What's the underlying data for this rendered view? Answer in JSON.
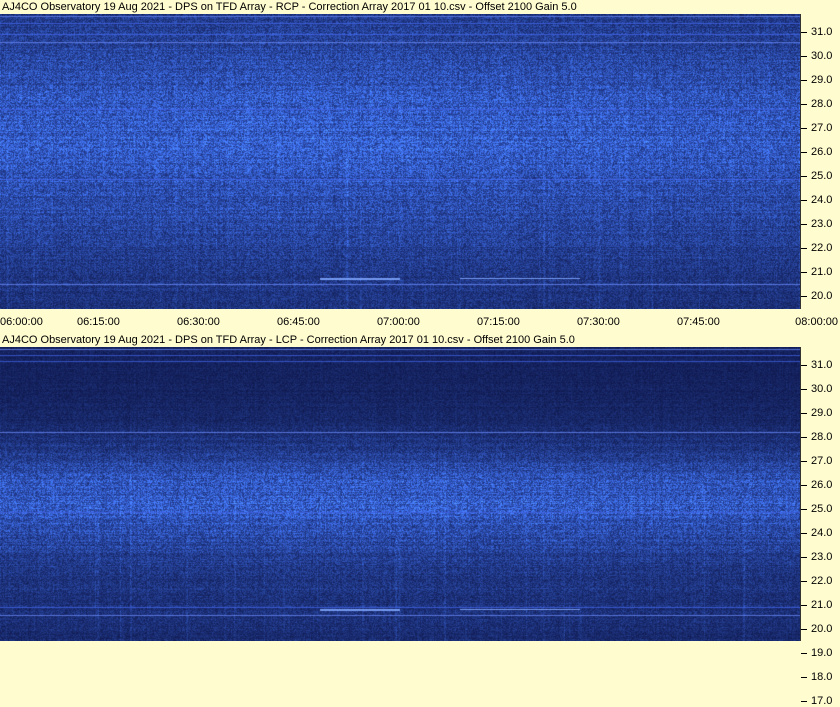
{
  "panels": [
    {
      "id": "rcp",
      "title": "AJ4CO Observatory 19 Aug 2021  -  DPS on TFD Array  -  RCP  -  Correction Array 2017 01 10.csv  -  Offset 2100  Gain 5.0",
      "polarization": "RCP"
    },
    {
      "id": "lcp",
      "title": "AJ4CO Observatory 19 Aug 2021  -  DPS on TFD Array  -  LCP  -  Correction Array 2017 01 10.csv  -  Offset 2100  Gain 5.0",
      "polarization": "LCP"
    }
  ],
  "frequency_axis_labels": [
    "31.0",
    "30.0",
    "29.0",
    "28.0",
    "27.0",
    "26.0",
    "25.0",
    "24.0",
    "23.0",
    "22.0",
    "21.0",
    "20.0",
    "19.0",
    "18.0",
    "17.0"
  ],
  "time_axis_labels": [
    "06:00:00",
    "06:15:00",
    "06:30:00",
    "06:45:00",
    "07:00:00",
    "07:15:00",
    "07:30:00",
    "07:45:00",
    "08:00:00"
  ],
  "colors": {
    "background": "#fffcd0",
    "spectrogram_dark": "#020a3a",
    "spectrogram_bright": "#3a6bff"
  }
}
